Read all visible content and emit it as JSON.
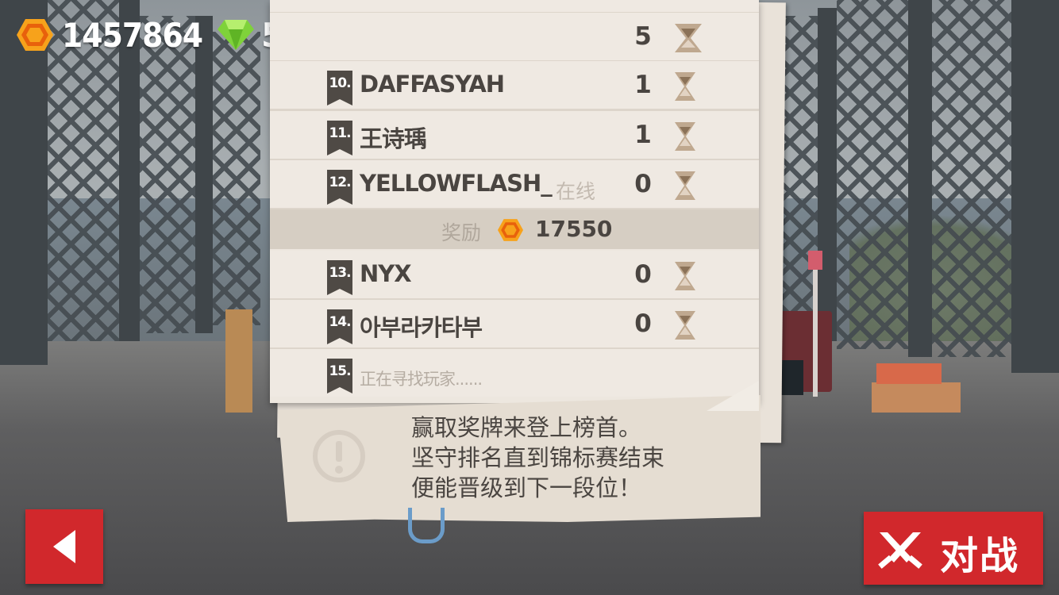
{
  "currency": {
    "coins": "1457864",
    "gems": "5"
  },
  "top_buttons": {
    "settings": "gear-icon",
    "inventory": "bag-icon",
    "add": "plus-icon"
  },
  "leaderboard": {
    "partial_row": {
      "name": "...",
      "score": "5"
    },
    "rows_before_reward": [
      {
        "rank": "10.",
        "name": "DAFFASYAH",
        "score": "1"
      },
      {
        "rank": "11.",
        "name": "王诗瑀",
        "score": "1"
      },
      {
        "rank": "12.",
        "name": "YELLOWFLASH_",
        "status": "在线",
        "score": "0"
      }
    ],
    "reward": {
      "label": "奖励",
      "amount": "17550"
    },
    "rows_after_reward": [
      {
        "rank": "13.",
        "name": "NYX",
        "score": "0"
      },
      {
        "rank": "14.",
        "name": "아부라카타부",
        "score": "0"
      },
      {
        "rank": "15.",
        "name": "正在寻找玩家......"
      }
    ]
  },
  "tip": {
    "line1": "赢取奖牌来登上榜首。",
    "line2": "坚守排名直到锦标赛结束",
    "line3": "便能晋级到下一段位！"
  },
  "buttons": {
    "back": "chevron-left-icon",
    "battle_label": "对战"
  },
  "colors": {
    "accent_red": "#d1282c",
    "coin_orange": "#f08a12",
    "gem_green": "#7fd23a",
    "paper": "#ede7df"
  }
}
